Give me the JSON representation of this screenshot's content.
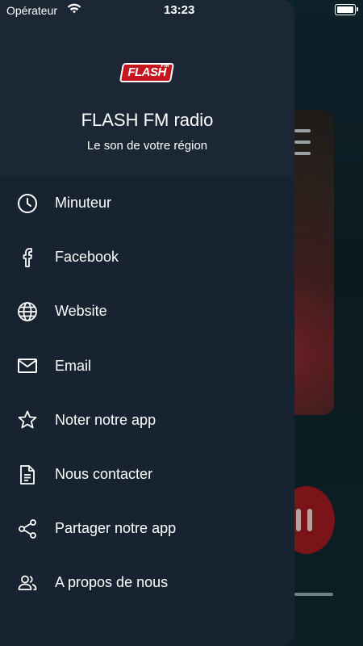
{
  "status_bar": {
    "carrier": "Opérateur",
    "time": "13:23"
  },
  "drawer": {
    "logo_text": "FLASH",
    "logo_fm": "FM",
    "title": "FLASH FM radio",
    "subtitle": "Le son de votre région",
    "items": [
      {
        "label": "Minuteur",
        "icon": "clock-icon"
      },
      {
        "label": "Facebook",
        "icon": "facebook-icon"
      },
      {
        "label": "Website",
        "icon": "globe-icon"
      },
      {
        "label": "Email",
        "icon": "mail-icon"
      },
      {
        "label": "Noter notre app",
        "icon": "star-icon"
      },
      {
        "label": "Nous contacter",
        "icon": "document-icon"
      },
      {
        "label": "Partager notre app",
        "icon": "share-icon"
      },
      {
        "label": "A propos de nous",
        "icon": "people-icon"
      }
    ]
  },
  "colors": {
    "drawer_bg": "#172330",
    "header_bg": "#1b2734",
    "accent_red": "#c4161c",
    "text": "#ffffff"
  }
}
